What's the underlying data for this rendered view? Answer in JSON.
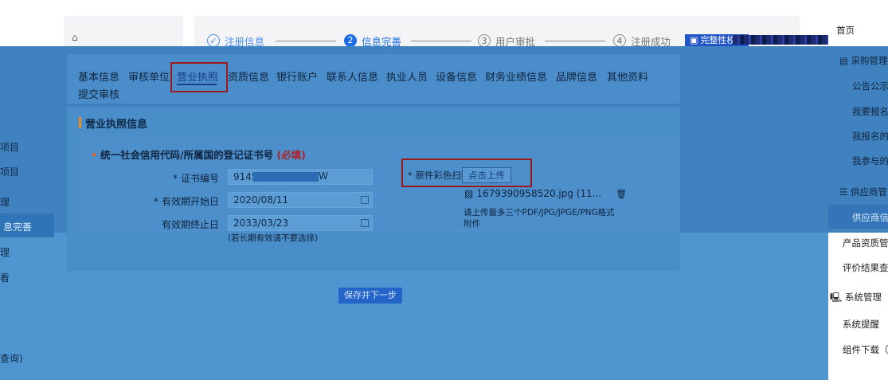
{
  "steps": [
    {
      "num": "✓",
      "label": "注册信息",
      "state": "done"
    },
    {
      "num": "2",
      "label": "信息完善",
      "state": "active"
    },
    {
      "num": "3",
      "label": "用户审批",
      "state": "todo"
    },
    {
      "num": "4",
      "label": "注册成功",
      "state": "todo"
    }
  ],
  "header": {
    "complete_btn": "完整性校验",
    "right_top": "首页"
  },
  "tabs": [
    "基本信息",
    "审核单位",
    "营业执照",
    "资质信息",
    "银行账户",
    "联系人信息",
    "执业人员",
    "设备信息",
    "财务业绩信息",
    "品牌信息",
    "其他资料",
    "提交审核"
  ],
  "section": {
    "title": "营业执照信息"
  },
  "license": {
    "field_head": "统一社会信用代码/所属国的登记证书号",
    "required_tag": "(必填)",
    "cert_no_label": "证书编号",
    "cert_no_value": "91450",
    "cert_no_suffix": "W",
    "start_label": "有效期开始日",
    "start_value": "2020/08/11",
    "end_label": "有效期终止日",
    "end_value": "2033/03/23",
    "expire_note": "(若长期有效请不要选择)",
    "upload_label": "原件彩色扫描件",
    "upload_btn": "点击上传",
    "file_name": "1679390958520.jpg (11...",
    "upload_hint": "请上传最多三个PDF/JPG/JPGE/PNG格式附件"
  },
  "save_button": "保存并下一步",
  "left_sidebar": [
    "项目",
    "项目",
    "理",
    "息完善",
    "理",
    "看",
    "查询)"
  ],
  "right_menu": {
    "group1": "采购管理",
    "items1": [
      "公告公示",
      "我要报名",
      "我报名的",
      "我参与的"
    ],
    "group2": "供应商管",
    "items2": [
      "供应商信",
      "产品资质管",
      "评价结果查"
    ],
    "group3": "系统管理",
    "items3": [
      "系统提醒",
      "组件下载（"
    ]
  },
  "colors": {
    "accent": "#1d6fe5",
    "overlay": "#4f95d0",
    "highlight_border": "#9a1b1b"
  }
}
